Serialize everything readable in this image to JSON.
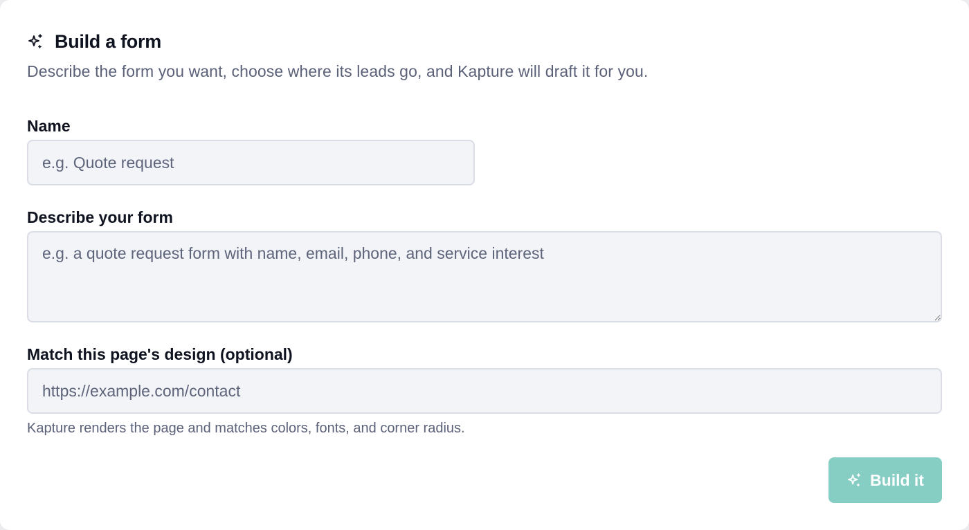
{
  "header": {
    "title": "Build a form",
    "title_icon": "sparkles-icon",
    "subtitle": "Describe the form you want, choose where its leads go, and Kapture will draft it for you."
  },
  "fields": {
    "name": {
      "label": "Name",
      "value": "",
      "placeholder": "e.g. Quote request"
    },
    "description": {
      "label": "Describe your form",
      "value": "",
      "placeholder": "e.g. a quote request form with name, email, phone, and service interest"
    },
    "design_url": {
      "label": "Match this page's design (optional)",
      "value": "",
      "placeholder": "https://example.com/contact",
      "help": "Kapture renders the page and matches colors, fonts, and corner radius."
    }
  },
  "actions": {
    "build_label": "Build it",
    "build_icon": "sparkles-icon",
    "build_enabled": false
  },
  "colors": {
    "accent_disabled": "#86cdc4",
    "field_background": "#f2f4f8",
    "text_primary": "#0f1320",
    "text_muted": "#5b6178"
  }
}
